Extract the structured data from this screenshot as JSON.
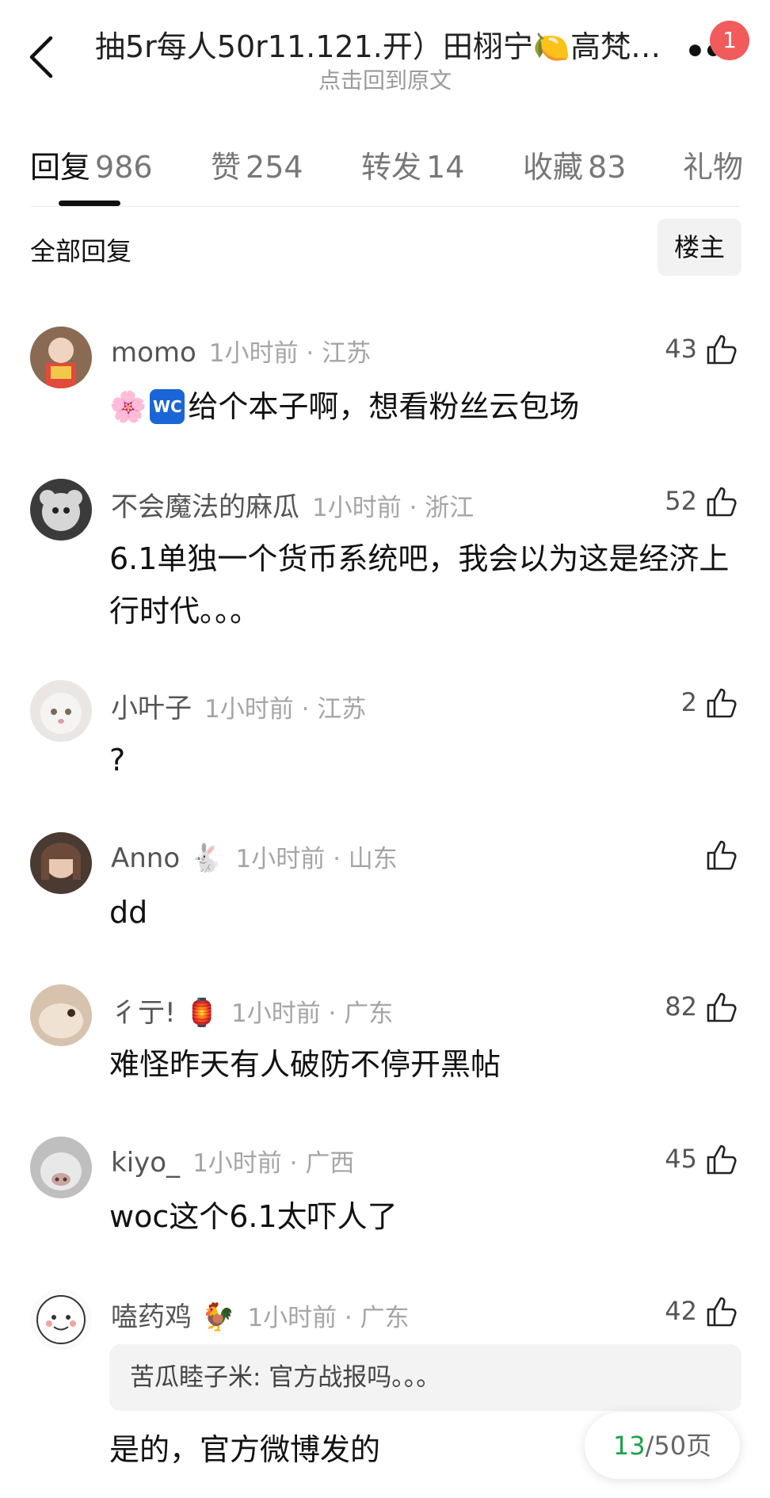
{
  "header": {
    "title": "抽5r每人50r11.121.开）田栩宁🍋高梵…",
    "subtitle": "点击回到原文",
    "notification_count": "1"
  },
  "tabs": [
    {
      "label": "回复",
      "count": "986"
    },
    {
      "label": "赞",
      "count": "254"
    },
    {
      "label": "转发",
      "count": "14"
    },
    {
      "label": "收藏",
      "count": "83"
    },
    {
      "label": "礼物",
      "count": ""
    }
  ],
  "filter": {
    "label": "全部回复",
    "owner_button": "楼主"
  },
  "comments": [
    {
      "user": "momo",
      "time": "1小时前 · 江苏",
      "likes": "43",
      "emoji": "",
      "prefix_emoji": "🌸",
      "badge": "WC",
      "text": "给个本子啊，想看粉丝云包场",
      "quote": ""
    },
    {
      "user": "不会魔法的麻瓜",
      "time": "1小时前 · 浙江",
      "likes": "52",
      "emoji": "",
      "text": "6.1单独一个货币系统吧，我会以为这是经济上行时代。。。",
      "quote": ""
    },
    {
      "user": "小叶子",
      "time": "1小时前 · 江苏",
      "likes": "2",
      "emoji": "",
      "text": "?",
      "quote": ""
    },
    {
      "user": "Anno",
      "time": "1小时前 · 山东",
      "likes": "",
      "emoji": "🐇",
      "text": "dd",
      "quote": ""
    },
    {
      "user": "彳亍!",
      "time": "1小时前 · 广东",
      "likes": "82",
      "emoji": "🏮",
      "text": "难怪昨天有人破防不停开黑帖",
      "quote": ""
    },
    {
      "user": "kiyo_",
      "time": "1小时前 · 广西",
      "likes": "45",
      "emoji": "",
      "text": "woc这个6.1太吓人了",
      "quote": ""
    },
    {
      "user": "嗑药鸡",
      "time": "1小时前 · 广东",
      "likes": "42",
      "emoji": "🐓",
      "text": "是的，官方微博发的",
      "quote": "苦瓜睦子米: 官方战报吗。。。"
    }
  ],
  "pagination": {
    "current": "13",
    "total": "/50页"
  }
}
